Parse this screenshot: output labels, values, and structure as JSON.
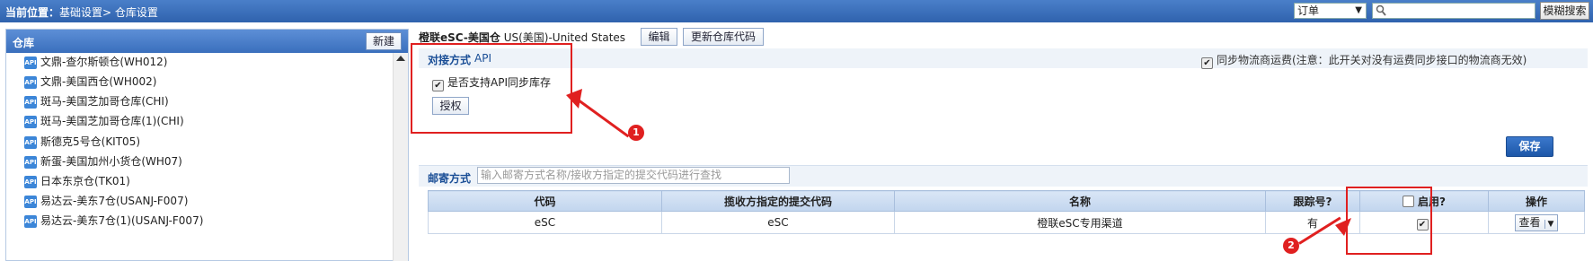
{
  "topbar": {
    "location_label": "当前位置：",
    "breadcrumb": "基础设置> 仓库设置",
    "order_select_value": "订单",
    "search_placeholder": "",
    "fuzzy_button": "模糊搜索"
  },
  "left": {
    "title": "仓库",
    "new_button": "新建",
    "api_badge": "API",
    "items": [
      {
        "label": "文鼎-查尔斯顿仓(WH012)"
      },
      {
        "label": "文鼎-美国西仓(WH002)"
      },
      {
        "label": "斑马-美国芝加哥仓库(CHI)"
      },
      {
        "label": "斑马-美国芝加哥仓库(1)(CHI)"
      },
      {
        "label": "斯德克5号仓(KIT05)"
      },
      {
        "label": "新蛋-美国加州小货仓(WH07)"
      },
      {
        "label": "日本东京仓(TK01)"
      },
      {
        "label": "易达云-美东7仓(USANJ-F007)"
      },
      {
        "label": "易达云-美东7仓(1)(USANJ-F007)"
      }
    ]
  },
  "warehouse": {
    "name": "橙联eSC-美国仓",
    "country": "US(美国)-United States",
    "edit_button": "编辑",
    "update_code_button": "更新仓库代码"
  },
  "connection": {
    "label": "对接方式",
    "value": "API",
    "sync_freight": "同步物流商运费(注意：此开关对没有运费同步接口的物流商无效)",
    "api_sync_label": "是否支持API同步库存",
    "authorize_button": "授权"
  },
  "annotations": {
    "badge1": "1",
    "badge2": "2",
    "color": "#e02020"
  },
  "save_button": "保存",
  "mail": {
    "label": "邮寄方式",
    "placeholder": "输入邮寄方式名称/接收方指定的提交代码进行查找"
  },
  "table": {
    "headers": {
      "code": "代码",
      "submit_code": "揽收方指定的提交代码",
      "name": "名称",
      "tracking": "跟踪号?",
      "enabled": "启用?",
      "ops": "操作"
    },
    "rows": [
      {
        "code": "eSC",
        "submit_code": "eSC",
        "name": "橙联eSC专用渠道",
        "tracking": "有",
        "view": "查看"
      }
    ]
  }
}
